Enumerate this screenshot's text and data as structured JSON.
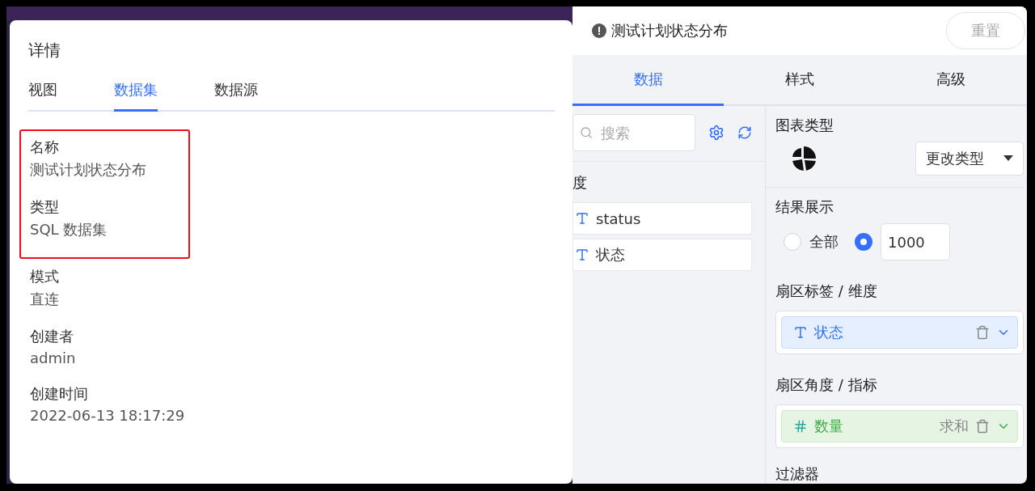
{
  "details": {
    "title": "详情",
    "tabs": [
      {
        "label": "视图",
        "selected": false
      },
      {
        "label": "数据集",
        "selected": true
      },
      {
        "label": "数据源",
        "selected": false
      }
    ],
    "groups": [
      {
        "highlighted": true,
        "fields": [
          {
            "label": "名称",
            "value": "测试计划状态分布"
          },
          {
            "label": "类型",
            "value": "SQL 数据集"
          }
        ]
      },
      {
        "highlighted": false,
        "fields": [
          {
            "label": "模式",
            "value": "直连"
          },
          {
            "label": "创建者",
            "value": "admin"
          },
          {
            "label": "创建时间",
            "value": "2022-06-13 18:17:29"
          }
        ]
      }
    ]
  },
  "editor": {
    "title": "测试计划状态分布",
    "reset_button": "重置",
    "tabs": [
      {
        "label": "数据",
        "selected": true
      },
      {
        "label": "样式",
        "selected": false
      },
      {
        "label": "高级",
        "selected": false
      }
    ],
    "search": {
      "placeholder": "搜索"
    },
    "field_group": "度",
    "fields": [
      {
        "kind": "text",
        "name": "status"
      },
      {
        "kind": "text",
        "name": "状态"
      }
    ],
    "chart_type": {
      "label": "图表类型",
      "change_button": "更改类型"
    },
    "result": {
      "label": "结果展示",
      "options": [
        {
          "label": "全部",
          "selected": false
        },
        {
          "value": "1000",
          "selected": true
        }
      ]
    },
    "drop_zones": [
      {
        "label": "扇区标签 / 维度",
        "chip": {
          "kind": "text",
          "name": "状态"
        }
      },
      {
        "label": "扇区角度 / 指标",
        "chip": {
          "kind": "number",
          "name": "数量",
          "aggregate": "求和"
        }
      }
    ],
    "filter_label": "过滤器"
  }
}
